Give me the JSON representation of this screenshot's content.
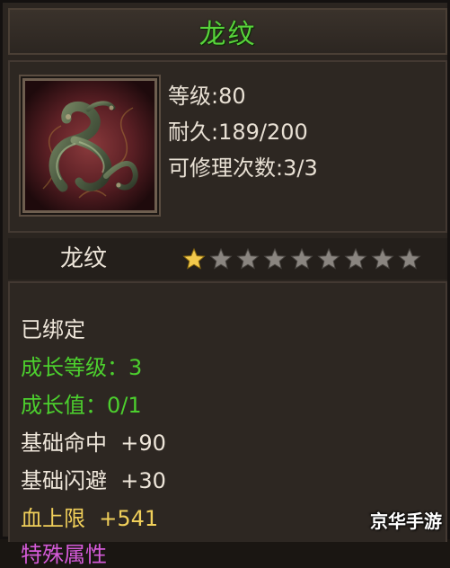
{
  "title": "龙纹",
  "item": {
    "icon": "dragon-emblem-icon",
    "stats": {
      "level": "等级:80",
      "durability": "耐久:189/200",
      "repair_count": "可修理次数:3/3"
    },
    "name": "龙纹",
    "star_rating": {
      "filled": 1,
      "total": 9
    }
  },
  "details": {
    "bound": "已绑定",
    "growth_level": "成长等级：3",
    "growth_value": "成长值：0/1",
    "base_accuracy": "基础命中  +90",
    "base_dodge": "基础闪避  +30",
    "hp_cap": "血上限  +541",
    "partial_line": "特殊属性"
  },
  "colors": {
    "title": "#58d23b",
    "green_attr": "#4ccf2e",
    "yellow_attr": "#f0cf5a",
    "magenta_attr": "#d45ad8",
    "star_filled": "#f2c94c",
    "star_empty": "#8a8580"
  },
  "watermark": "京华手游"
}
